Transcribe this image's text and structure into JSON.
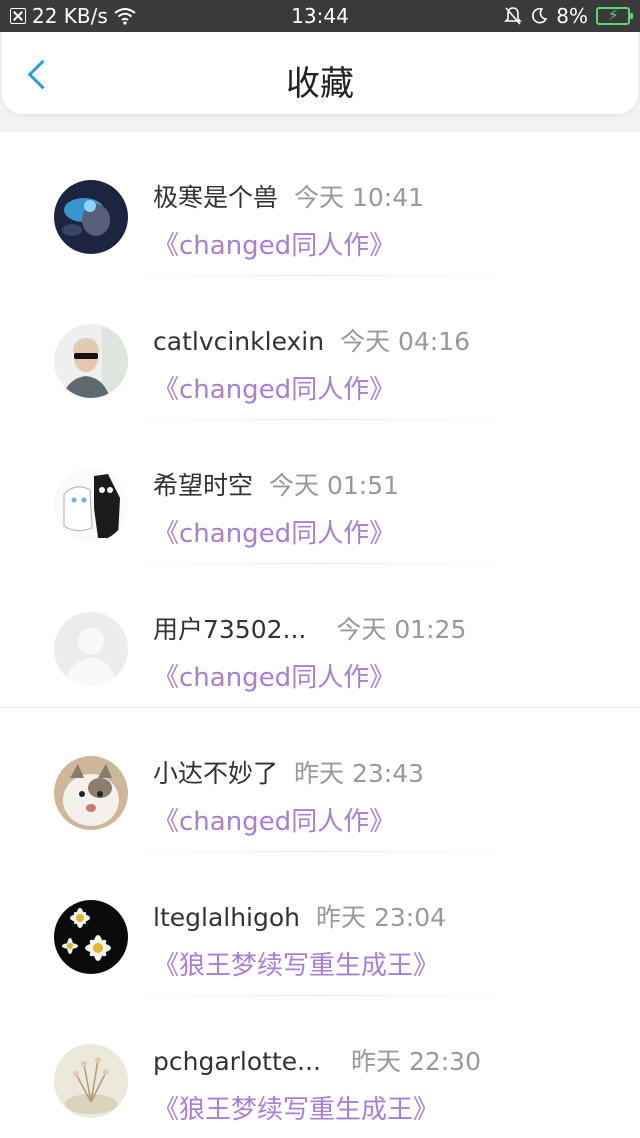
{
  "status_bar": {
    "speed": "22 KB/s",
    "time": "13:44",
    "battery": "8%"
  },
  "header": {
    "title": "收藏"
  },
  "items": [
    {
      "name": "极寒是个兽",
      "time": "今天 10:41",
      "novel": "《changed同人作》"
    },
    {
      "name": "catlvcinklexin",
      "time": "今天 04:16",
      "novel": "《changed同人作》"
    },
    {
      "name": "希望时空",
      "time": "今天 01:51",
      "novel": "《changed同人作》"
    },
    {
      "name": "用户73502...",
      "time": "今天 01:25",
      "novel": "《changed同人作》"
    },
    {
      "name": "小达不妙了",
      "time": "昨天 23:43",
      "novel": "《changed同人作》"
    },
    {
      "name": "lteglalhigoh",
      "time": "昨天 23:04",
      "novel": "《狼王梦续写重生成王》"
    },
    {
      "name": "pchgarlotte...",
      "time": "昨天 22:30",
      "novel": "《狼王梦续写重生成王》"
    }
  ]
}
